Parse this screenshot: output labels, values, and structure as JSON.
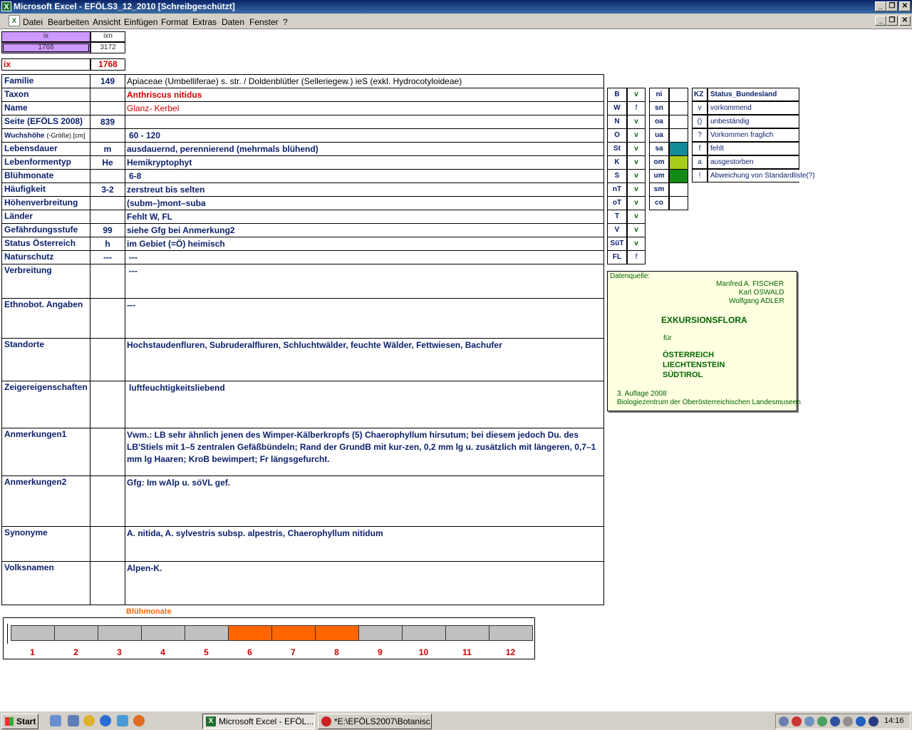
{
  "window": {
    "title": "Microsoft Excel - EFÖLS3_12_2010  [Schreibgeschützt]"
  },
  "menu": [
    "Datei",
    "Bearbeiten",
    "Ansicht",
    "Einfügen",
    "Format",
    "Extras",
    "Daten",
    "Fenster",
    "?"
  ],
  "index": {
    "ix_header": "ix",
    "ixn_header": "ixn",
    "ix_value": "1768",
    "ixn_value": "3172",
    "ix_label": "ix",
    "ix_big": "1768"
  },
  "rows": [
    {
      "label": "Familie",
      "code": "149",
      "text": "Apiaceae (Umbelliferae) s. str.  /  Doldenblütler (Selleriegew.) ieS (exkl. Hydrocotyloideae)"
    },
    {
      "label": "Taxon",
      "code": "",
      "text": "Anthriscus nitidus"
    },
    {
      "label": "Name",
      "code": "",
      "text": "Glanz- Kerbel"
    },
    {
      "label": "Seite (EFÖLS 2008)",
      "code": "839",
      "text": ""
    },
    {
      "label": "Wuchshöhe",
      "label_suffix": "(-Größe) [cm]",
      "code": "",
      "text": "60 - 120"
    },
    {
      "label": "Lebensdauer",
      "code": "m",
      "text": "ausdauernd, perennierend (mehrmals blühend)"
    },
    {
      "label": "Lebenformentyp",
      "code": "He",
      "text": "Hemikryptophyt"
    },
    {
      "label": "Blühmonate",
      "code": "",
      "text": "6-8"
    },
    {
      "label": "Häufigkeit",
      "code": "3-2",
      "text": "zerstreut bis selten"
    },
    {
      "label": "Höhenverbreitung",
      "code": "",
      "text": "(subm–)mont–suba"
    },
    {
      "label": "Länder",
      "code": "",
      "text": "Fehlt W, FL"
    },
    {
      "label": "Gefährdungsstufe",
      "code": "99",
      "text": "siehe Gfg bei Anmerkung2"
    },
    {
      "label": "Status Österreich",
      "code": "h",
      "text": "im Gebiet (=Ö) heimisch"
    },
    {
      "label": "Naturschutz",
      "code": "---",
      "text": "---"
    },
    {
      "label": "Verbreitung",
      "code": "",
      "text": "---"
    },
    {
      "label": "Ethnobot. Angaben",
      "code": "",
      "text": "---"
    },
    {
      "label": "Standorte",
      "code": "",
      "text": "Hochstaudenfluren, Subruderalfluren, Schluchtwälder, feuchte Wälder, Fettwiesen, Bachufer"
    },
    {
      "label": "Zeigereigenschaften",
      "code": "",
      "text": "luftfeuchtigkeitsliebend"
    },
    {
      "label": "Anmerkungen1",
      "code": "",
      "text": "Vwm.: LB sehr ähnlich jenen des Wimper-Kälberkropfs (5) Chaerophyllum hirsutum; bei diesem jedoch Du. des LB'Stiels mit 1–5 zentralen Gefäßbündeln; Rand der GrundB mit kur-zen, 0,2 mm lg u. zusätzlich mit längeren, 0,7–1 mm lg Haaren; KroB bewimpert; Fr längsgefurcht."
    },
    {
      "label": "Anmerkungen2",
      "code": "",
      "text": "Gfg:  Im wAlp u. söVL gef."
    },
    {
      "label": "Synonyme",
      "code": "",
      "text": "A. nitida, A. sylvestris subsp. alpestris, Chaerophyllum nitidum"
    },
    {
      "label": "Volksnamen",
      "code": "",
      "text": "Alpen-K."
    }
  ],
  "states": [
    {
      "code": "B",
      "status": "v"
    },
    {
      "code": "W",
      "status": "f"
    },
    {
      "code": "N",
      "status": "v"
    },
    {
      "code": "O",
      "status": "v"
    },
    {
      "code": "St",
      "status": "v"
    },
    {
      "code": "K",
      "status": "v"
    },
    {
      "code": "S",
      "status": "v"
    },
    {
      "code": "nT",
      "status": "v"
    },
    {
      "code": "oT",
      "status": "v"
    },
    {
      "code": "T",
      "status": "v"
    },
    {
      "code": "V",
      "status": "v"
    },
    {
      "code": "SüT",
      "status": "v"
    },
    {
      "code": "FL",
      "status": "f"
    }
  ],
  "zones": [
    {
      "code": "ni",
      "color": ""
    },
    {
      "code": "sn",
      "color": ""
    },
    {
      "code": "oa",
      "color": ""
    },
    {
      "code": "ua",
      "color": ""
    },
    {
      "code": "sa",
      "color": "#138a99"
    },
    {
      "code": "om",
      "color": "#a8cc1a"
    },
    {
      "code": "um",
      "color": "#138a13"
    },
    {
      "code": "sm",
      "color": ""
    },
    {
      "code": "co",
      "color": ""
    }
  ],
  "legend": {
    "header_kz": "KZ",
    "header_status": "Status_Bundesland",
    "items": [
      {
        "kz": "v",
        "text": "vorkommend"
      },
      {
        "kz": "()",
        "text": "unbeständig"
      },
      {
        "kz": "?",
        "text": "Vorkommen fraglich"
      },
      {
        "kz": "f",
        "text": "fehlt"
      },
      {
        "kz": "a",
        "text": "ausgestorben"
      },
      {
        "kz": "!",
        "text": "Abweichung von Standardliste(?)"
      }
    ]
  },
  "datenquelle": {
    "label": "Datenquelle:",
    "author1": "Manfred A. FISCHER",
    "author2": "Karl OSWALD",
    "author3": "Wolfgang ADLER",
    "title": "EXKURSIONSFLORA",
    "fuer": "für",
    "country1": "ÖSTERREICH",
    "country2": "LIECHTENSTEIN",
    "country3": "SÜDTIROL",
    "edition": "3. Auflage 2008",
    "publisher": "Biologiezentrum der Oberösterreichischen Landesmuseen"
  },
  "bloom": {
    "title": "Blühmonate",
    "months": [
      "1",
      "2",
      "3",
      "4",
      "5",
      "6",
      "7",
      "8",
      "9",
      "10",
      "11",
      "12"
    ],
    "active": [
      6,
      7,
      8
    ],
    "active_color": "#ff6600",
    "inactive_color": "#c0c0c0"
  },
  "taskbar": {
    "start": "Start",
    "tasks": [
      "Microsoft Excel - EFÖL...",
      "*E:\\EFÖLS2007\\Botanisc..."
    ],
    "clock": "14:16"
  }
}
